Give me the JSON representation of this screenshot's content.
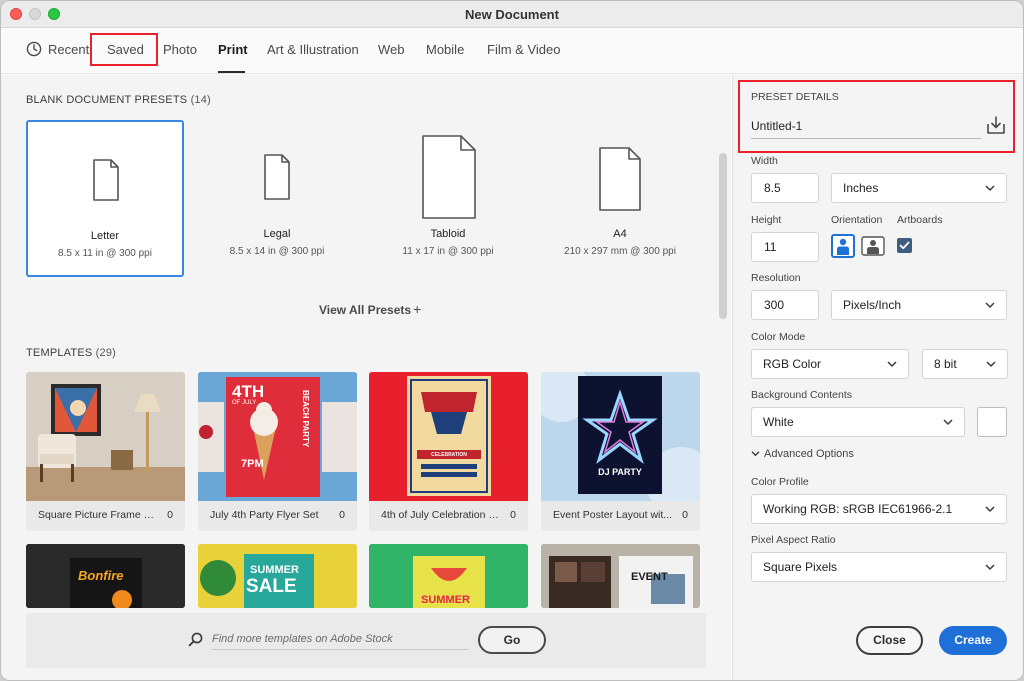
{
  "window": {
    "title": "New Document"
  },
  "tabs": [
    {
      "label": "Recent"
    },
    {
      "label": "Saved"
    },
    {
      "label": "Photo"
    },
    {
      "label": "Print"
    },
    {
      "label": "Art & Illustration"
    },
    {
      "label": "Web"
    },
    {
      "label": "Mobile"
    },
    {
      "label": "Film & Video"
    }
  ],
  "active_tab": "Print",
  "presets": {
    "heading": "BLANK DOCUMENT PRESETS",
    "count": "(14)",
    "items": [
      {
        "name": "Letter",
        "dims": "8.5 x 11 in @ 300 ppi"
      },
      {
        "name": "Legal",
        "dims": "8.5 x 14 in @ 300 ppi"
      },
      {
        "name": "Tabloid",
        "dims": "11 x 17 in @ 300 ppi"
      },
      {
        "name": "A4",
        "dims": "210 x 297 mm @ 300 ppi"
      }
    ],
    "view_all": "View All Presets",
    "view_all_plus": "+"
  },
  "templates": {
    "heading": "TEMPLATES",
    "count": "(29)",
    "items": [
      {
        "caption": "Square Picture Frame M...",
        "count": "0"
      },
      {
        "caption": "July 4th Party Flyer Set",
        "count": "0"
      },
      {
        "caption": "4th of July Celebration Fl...",
        "count": "0"
      },
      {
        "caption": "Event Poster Layout wit...",
        "count": "0"
      }
    ],
    "thumb_text": {
      "flyer_4th": "4TH",
      "flyer_of_july": "OF JULY",
      "flyer_beach": "BEACH PARTY",
      "flyer_time": "7PM",
      "celebration": "CELEBRATION",
      "dj_party": "DJ PARTY",
      "bonfire": "Bonfire",
      "summer_sale_1": "SUMMER",
      "summer_sale_2": "SALE",
      "summer": "SUMMER",
      "event": "EVENT"
    }
  },
  "stock": {
    "placeholder": "Find more templates on Adobe Stock",
    "go_label": "Go"
  },
  "preset_details": {
    "heading": "PRESET DETAILS",
    "doc_name": "Untitled-1",
    "width_label": "Width",
    "width_value": "8.5",
    "width_unit": "Inches",
    "height_label": "Height",
    "height_value": "11",
    "orientation_label": "Orientation",
    "artboards_label": "Artboards",
    "resolution_label": "Resolution",
    "resolution_value": "300",
    "resolution_unit": "Pixels/Inch",
    "color_mode_label": "Color Mode",
    "color_mode_value": "RGB Color",
    "bit_depth": "8 bit",
    "background_label": "Background Contents",
    "background_value": "White",
    "advanced_label": "Advanced Options",
    "color_profile_label": "Color Profile",
    "color_profile_value": "Working RGB: sRGB IEC61966-2.1",
    "pixel_aspect_label": "Pixel Aspect Ratio",
    "pixel_aspect_value": "Square Pixels"
  },
  "actions": {
    "close_label": "Close",
    "create_label": "Create"
  },
  "colors": {
    "accent": "#1f6fd8",
    "selection": "#3a87e3",
    "highlight_box": "#e8212b"
  }
}
